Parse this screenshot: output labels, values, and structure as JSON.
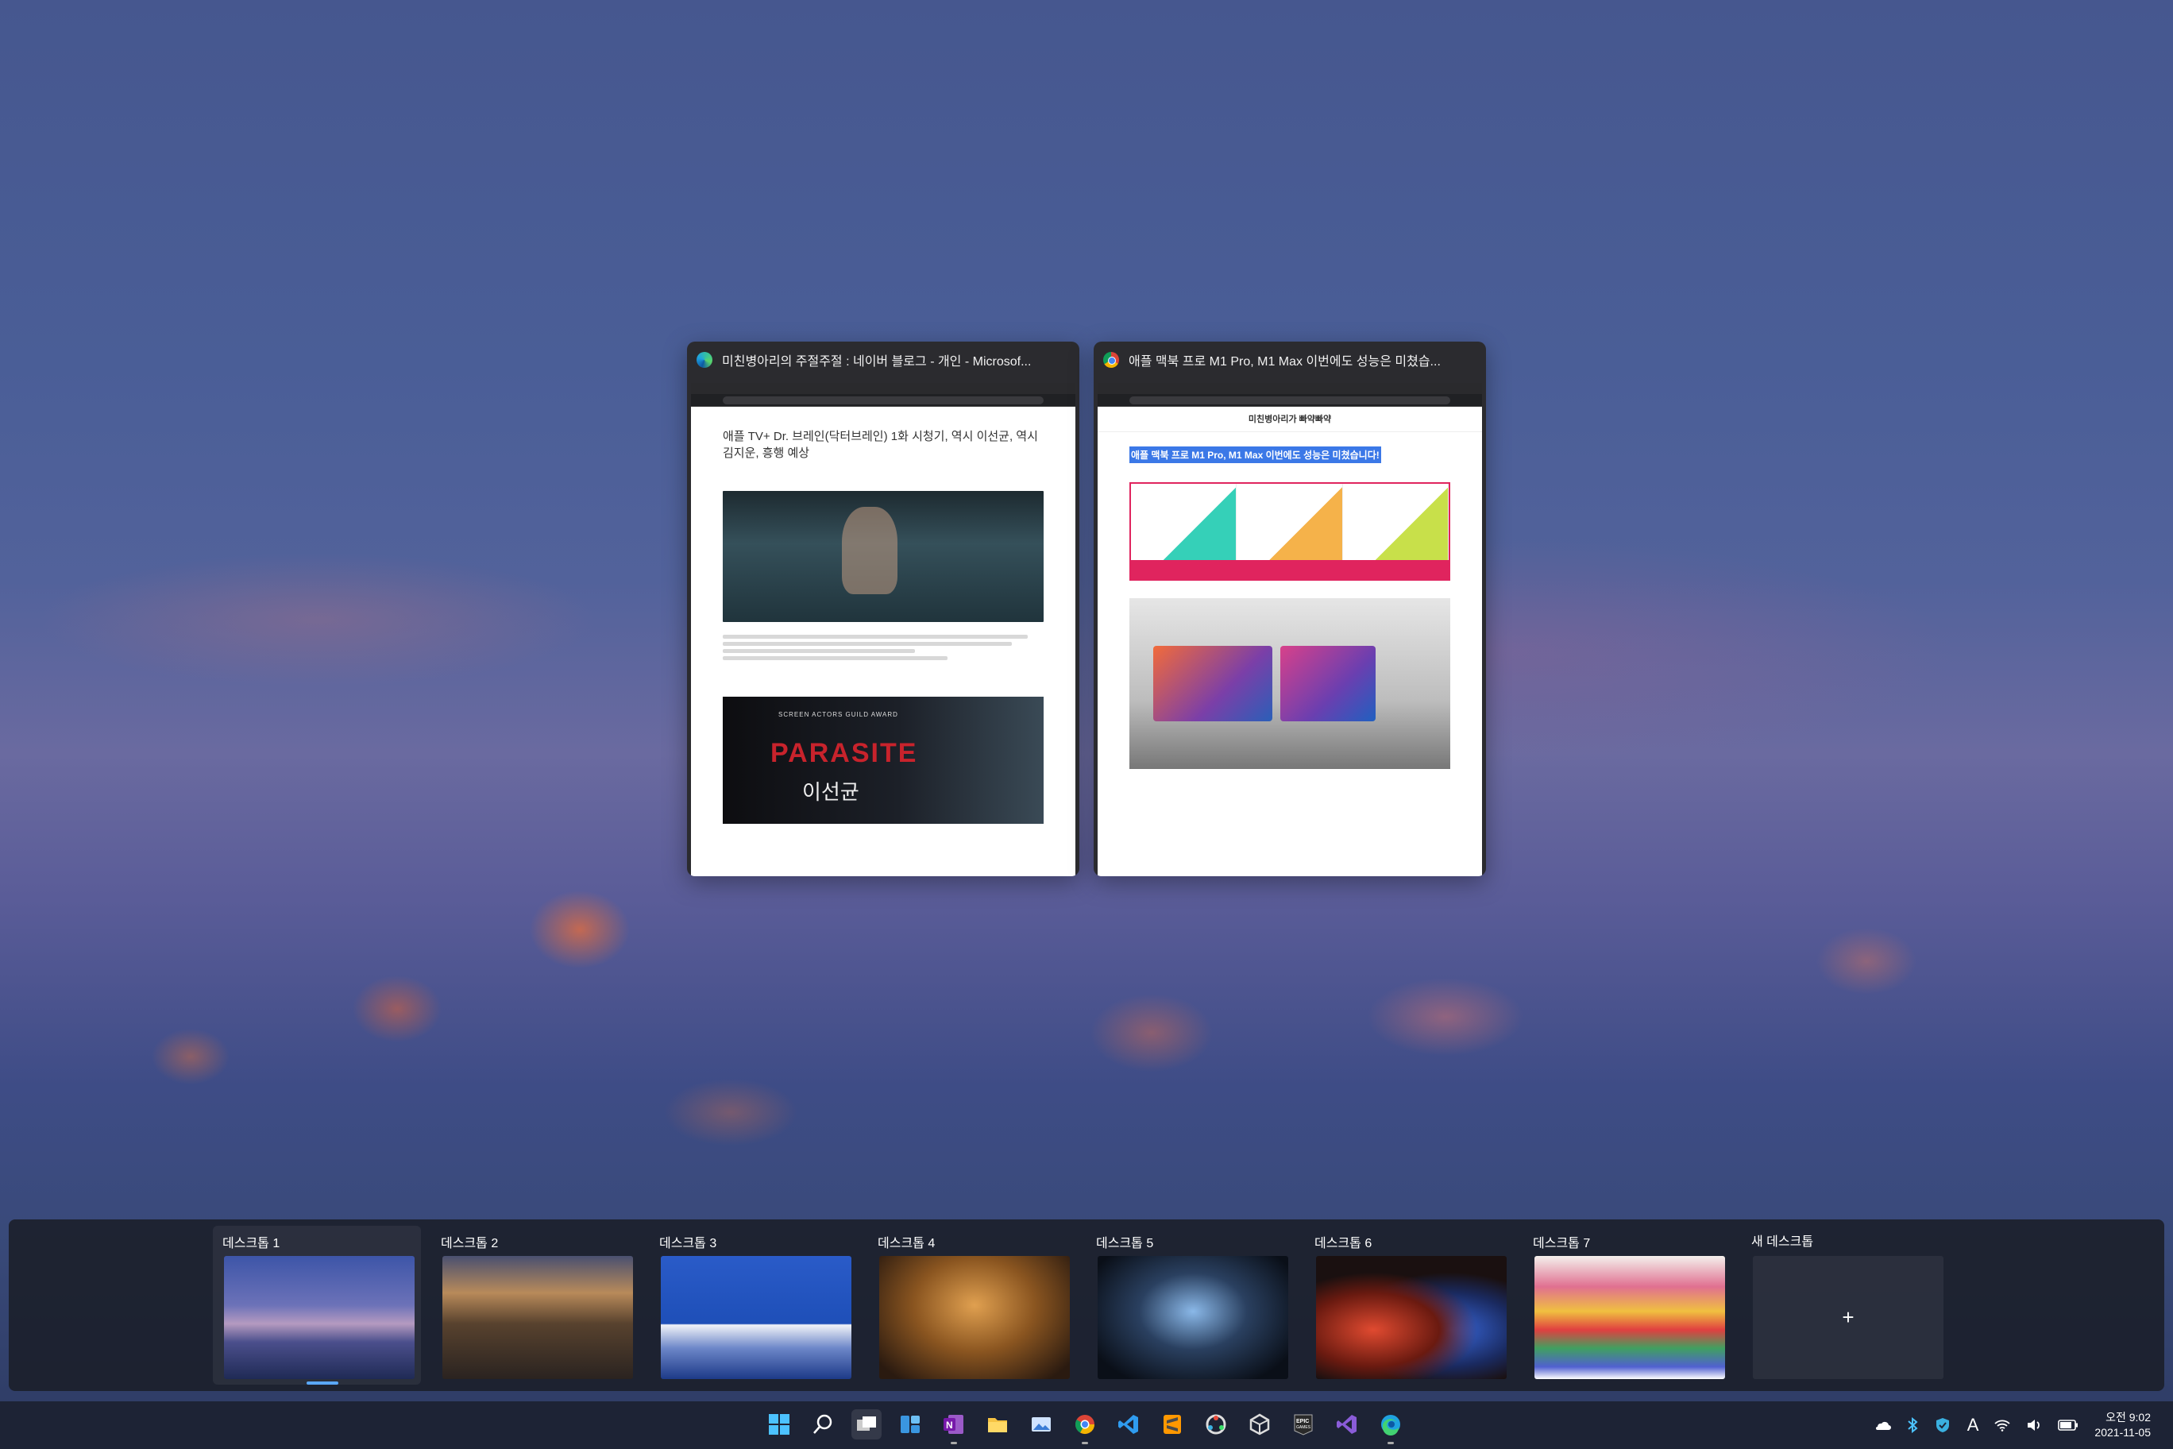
{
  "windows": [
    {
      "title": "미친병아리의 주절주절 : 네이버 블로그 - 개인 - Microsof...",
      "app": "edge-icon",
      "page": {
        "headline": "애플 TV+ Dr. 브레인(닥터브레인) 1화 시청기, 역시 이선균, 역시 김지운, 흥행 예상",
        "poster_top": "SCREEN ACTORS GUILD AWARD",
        "poster_main": "PARASITE",
        "poster_sub": "이선균"
      }
    },
    {
      "title": "애플 맥북 프로 M1 Pro, M1 Max 이번에도 성능은 미쳤습...",
      "app": "chrome-icon",
      "page": {
        "blog_name": "미친병아리가 빠약빠약",
        "headline": "애플 맥북 프로 M1 Pro, M1 Max 이번에도 성능은 미쳤습니다!"
      }
    }
  ],
  "desktops": [
    {
      "label": "데스크톱 1",
      "active": true
    },
    {
      "label": "데스크톱 2",
      "active": false
    },
    {
      "label": "데스크톱 3",
      "active": false
    },
    {
      "label": "데스크톱 4",
      "active": false
    },
    {
      "label": "데스크톱 5",
      "active": false
    },
    {
      "label": "데스크톱 6",
      "active": false
    },
    {
      "label": "데스크톱 7",
      "active": false
    }
  ],
  "new_desktop": {
    "label": "새 데스크톱",
    "icon": "+"
  },
  "taskbar": {
    "apps": [
      "start",
      "search",
      "task-view",
      "widgets",
      "onenote",
      "file-explorer",
      "photos",
      "chrome",
      "vscode",
      "sublime-text",
      "davinci",
      "unity",
      "epic-games",
      "visual-studio",
      "edge"
    ],
    "tray": {
      "ime": "A",
      "time": "오전 9:02",
      "date": "2021-11-05"
    }
  },
  "colors": {
    "accent": "#5aa8ff",
    "selection": "#3b78e7",
    "taskbar": "#1d2335"
  }
}
